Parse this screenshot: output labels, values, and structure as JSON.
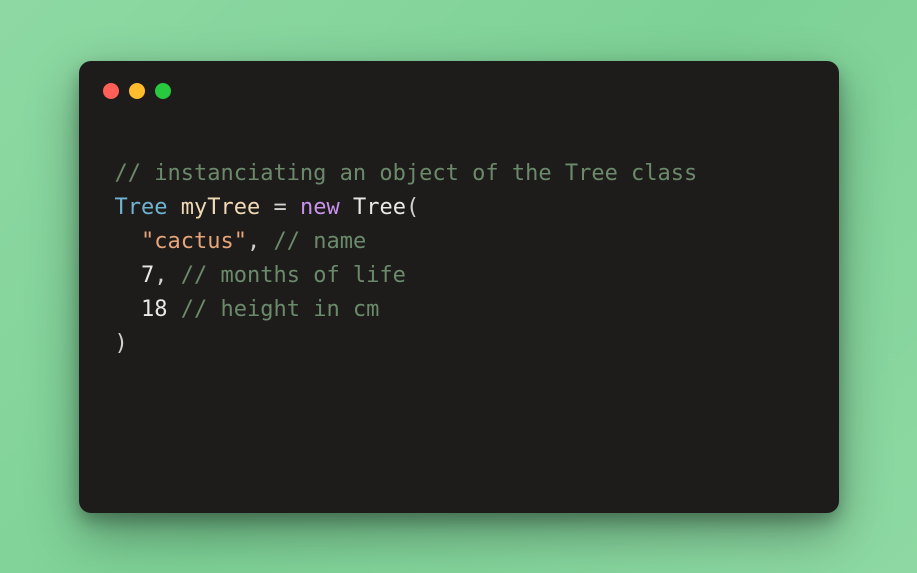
{
  "window": {
    "traffic_lights": [
      "red",
      "yellow",
      "green"
    ]
  },
  "code": {
    "line1_comment": "// instanciating an object of the Tree class",
    "line2": {
      "type": "Tree",
      "ident": "myTree",
      "op": "=",
      "keyword": "new",
      "class": "Tree",
      "open": "("
    },
    "line3": {
      "indent": "  ",
      "string": "\"cactus\"",
      "comma": ",",
      "comment": "// name"
    },
    "line4": {
      "indent": "  ",
      "number": "7",
      "comma": ",",
      "comment": "// months of life"
    },
    "line5": {
      "indent": "  ",
      "number": "18",
      "comment": "// height in cm"
    },
    "line6_close": ")"
  }
}
